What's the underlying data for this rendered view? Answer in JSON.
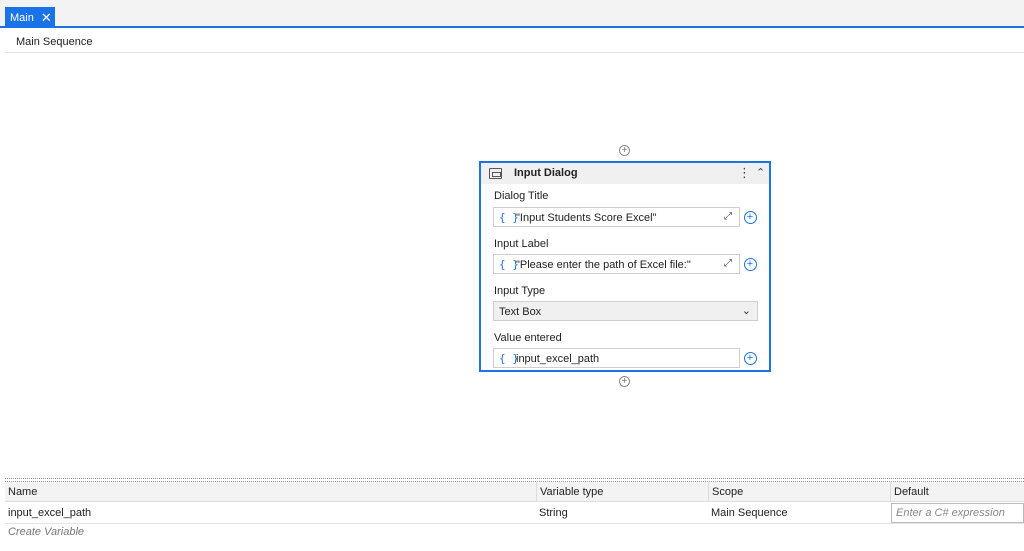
{
  "tabs": [
    {
      "label": "Main",
      "close": "✕"
    }
  ],
  "breadcrumb": "Main Sequence",
  "activity": {
    "title": "Input Dialog",
    "more_glyph": "⋮",
    "collapse_glyph": "⌃",
    "fields": {
      "dialog_title": {
        "label": "Dialog Title",
        "value": "\"Input Students Score Excel\""
      },
      "input_label": {
        "label": "Input Label",
        "value": "\"Please enter the path of Excel file:\""
      },
      "input_type": {
        "label": "Input Type",
        "value": "Text Box"
      },
      "value_entered": {
        "label": "Value entered",
        "value": "input_excel_path"
      }
    },
    "braces": "{ }",
    "plus": "+",
    "expand_glyph": "⤢",
    "chevron": "⌄"
  },
  "variables": {
    "headers": {
      "name": "Name",
      "type": "Variable type",
      "scope": "Scope",
      "default": "Default"
    },
    "rows": [
      {
        "name": "input_excel_path",
        "type": "String",
        "scope": "Main Sequence",
        "default_placeholder": "Enter a C# expression"
      }
    ],
    "create_label": "Create Variable"
  },
  "colors": {
    "accent": "#1a73e8"
  }
}
